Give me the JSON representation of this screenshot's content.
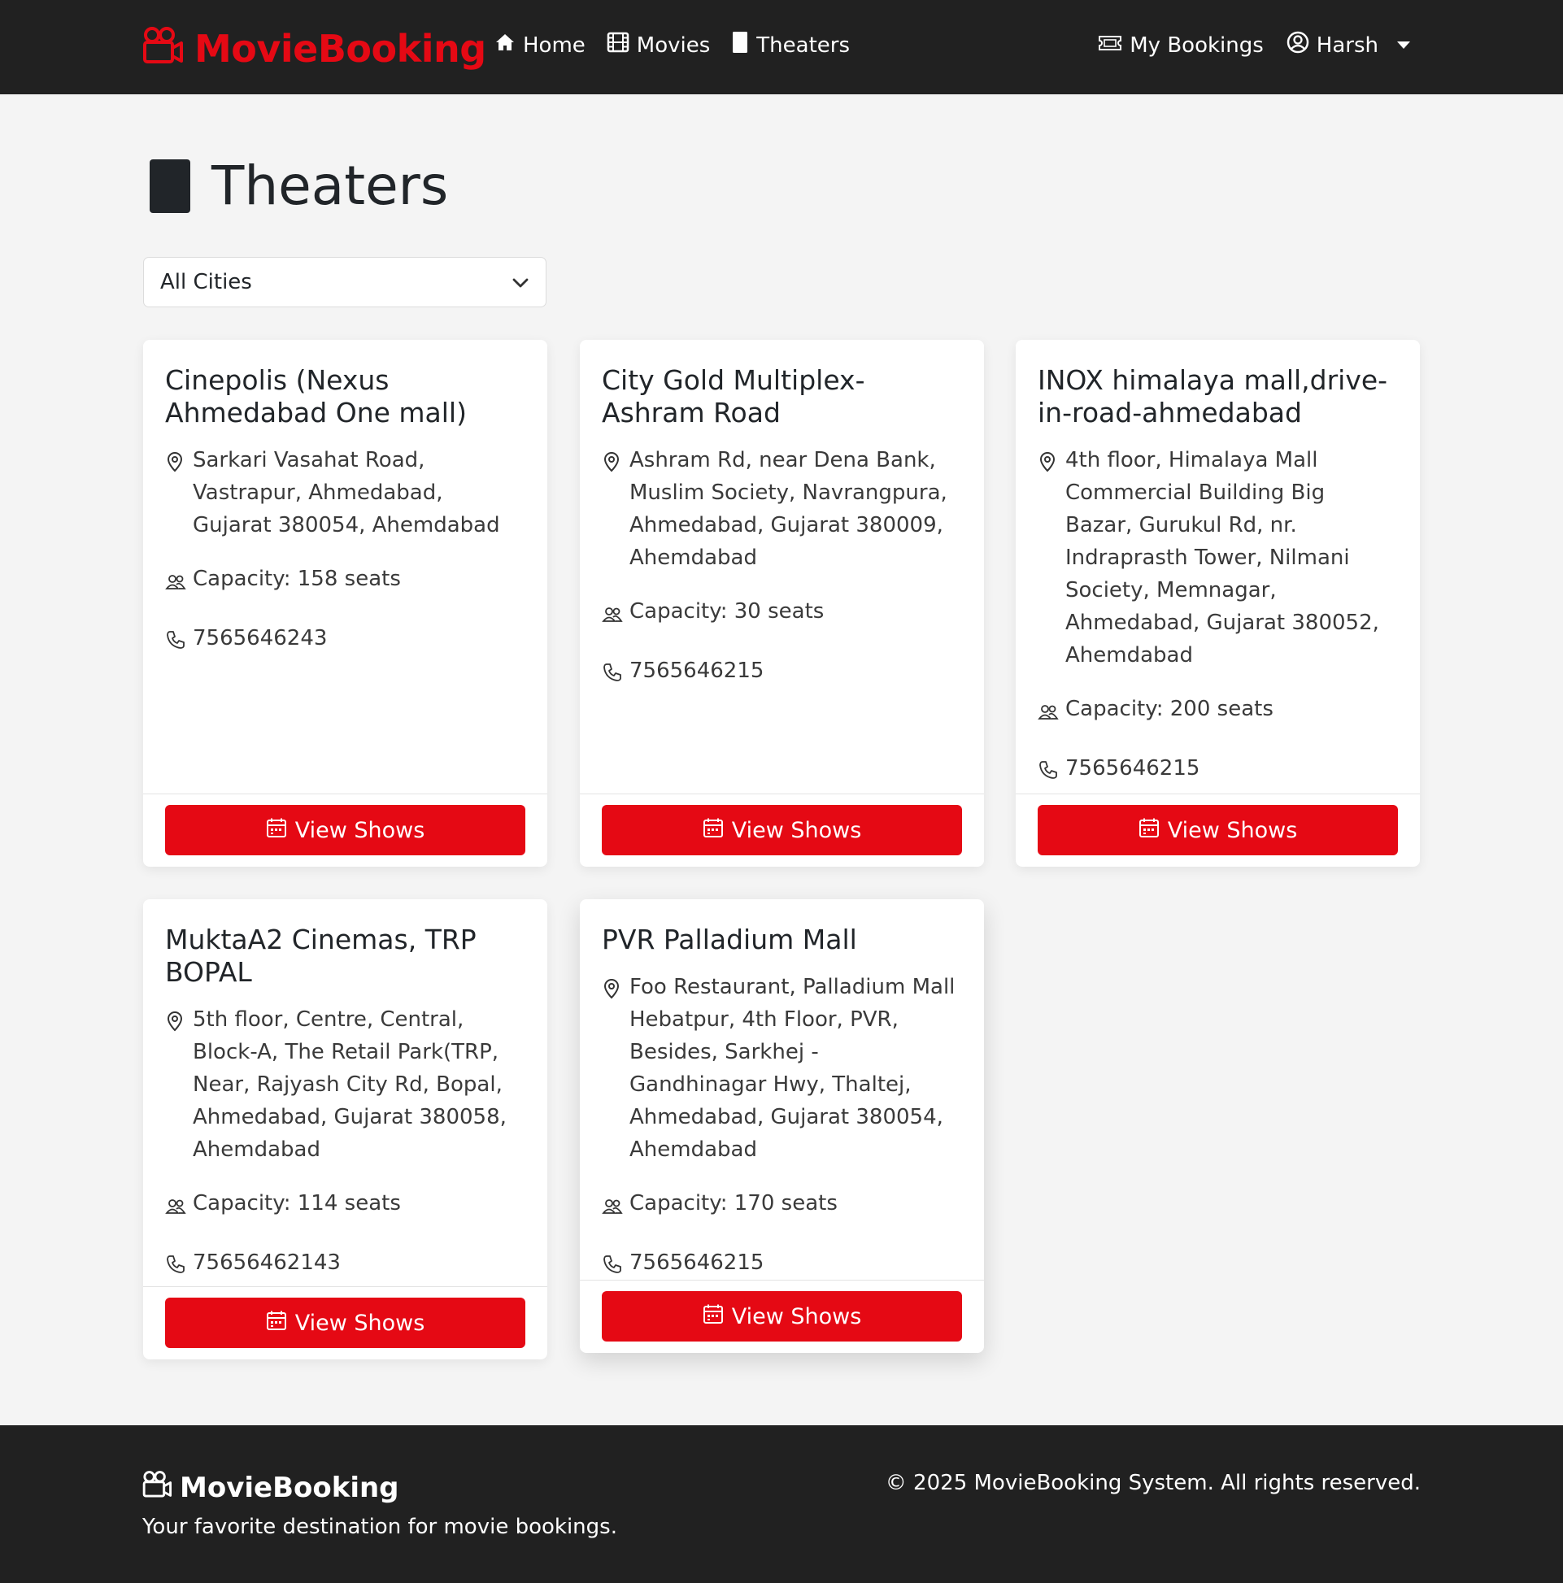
{
  "navbar": {
    "brand": "MovieBooking",
    "links": [
      {
        "label": "Home",
        "icon": "home-icon"
      },
      {
        "label": "Movies",
        "icon": "film-icon"
      },
      {
        "label": "Theaters",
        "icon": "theater-icon"
      }
    ],
    "my_bookings": "My Bookings",
    "user_name": "Harsh"
  },
  "page": {
    "title": "Theaters",
    "city_filter": {
      "selected": "All Cities"
    }
  },
  "theaters": [
    {
      "name": "Cinepolis (Nexus Ahmedabad One mall)",
      "address": "Sarkari Vasahat Road, Vastrapur, Ahmedabad, Gujarat 380054, Ahemdabad",
      "capacity": "Capacity: 158 seats",
      "phone": "7565646243",
      "button": "View Shows"
    },
    {
      "name": "City Gold Multiplex- Ashram Road",
      "address": "Ashram Rd, near Dena Bank, Muslim Society, Navrangpura, Ahmedabad, Gujarat 380009, Ahemdabad",
      "capacity": "Capacity: 30 seats",
      "phone": "7565646215",
      "button": "View Shows"
    },
    {
      "name": "INOX himalaya mall,drive-in-road-ahmedabad",
      "address": "4th floor, Himalaya Mall Commercial Building Big Bazar, Gurukul Rd, nr. Indraprasth Tower, Nilmani Society, Memnagar, Ahmedabad, Gujarat 380052, Ahemdabad",
      "capacity": "Capacity: 200 seats",
      "phone": "7565646215",
      "button": "View Shows"
    },
    {
      "name": "MuktaA2 Cinemas, TRP BOPAL",
      "address": "5th floor, Centre, Central, Block-A, The Retail Park(TRP, Near, Rajyash City Rd, Bopal, Ahmedabad, Gujarat 380058, Ahemdabad",
      "capacity": "Capacity: 114 seats",
      "phone": "75656462143",
      "button": "View Shows"
    },
    {
      "name": "PVR Palladium Mall",
      "address": "Foo Restaurant, Palladium Mall Hebatpur, 4th Floor, PVR, Besides, Sarkhej - Gandhinagar Hwy, Thaltej, Ahmedabad, Gujarat 380054, Ahemdabad",
      "capacity": "Capacity: 170 seats",
      "phone": "7565646215",
      "button": "View Shows"
    }
  ],
  "footer": {
    "brand": "MovieBooking",
    "tagline": "Your favorite destination for movie bookings.",
    "copyright": "© 2025 MovieBooking System. All rights reserved."
  },
  "colors": {
    "accent": "#e50914",
    "navbar_bg": "#212121",
    "page_bg": "#f4f4f4"
  }
}
